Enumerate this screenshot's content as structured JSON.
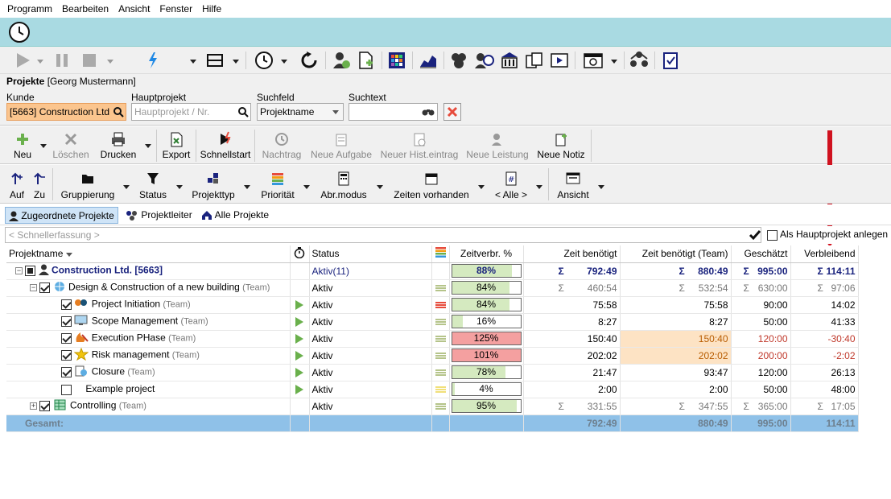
{
  "menu": [
    "Programm",
    "Bearbeiten",
    "Ansicht",
    "Fenster",
    "Hilfe"
  ],
  "header": {
    "title": "Projekte",
    "user": "[Georg Mustermann]"
  },
  "filters": {
    "kunde_label": "Kunde",
    "kunde_value": "[5663] Construction Ltd",
    "haupt_label": "Hauptprojekt",
    "haupt_placeholder": "Hauptprojekt / Nr.",
    "such_label": "Suchfeld",
    "such_value": "Projektname",
    "text_label": "Suchtext",
    "text_value": ""
  },
  "toolbar2": {
    "neu": "Neu",
    "loeschen": "Löschen",
    "drucken": "Drucken",
    "export": "Export",
    "schnellstart": "Schnellstart",
    "nachtrag": "Nachtrag",
    "neue_aufgabe": "Neue Aufgabe",
    "neuer_hist": "Neuer Hist.eintrag",
    "neue_leistung": "Neue Leistung",
    "neue_notiz": "Neue Notiz"
  },
  "toolbar3": {
    "auf": "Auf",
    "zu": "Zu",
    "gruppierung": "Gruppierung",
    "status": "Status",
    "projekttyp": "Projekttyp",
    "prioritaet": "Priorität",
    "abrmodus": "Abr.modus",
    "zeiten": "Zeiten vorhanden",
    "alle": "< Alle >",
    "ansicht": "Ansicht"
  },
  "viewtabs": [
    "Zugeordnete Projekte",
    "Projektleiter",
    "Alle Projekte"
  ],
  "quick": {
    "placeholder": "< Schnellerfassung >",
    "checkbox_label": "Als Hauptprojekt anlegen"
  },
  "columns": {
    "name": "Projektname",
    "status": "Status",
    "zeitverbr": "Zeitverbr. %",
    "zeit": "Zeit benötigt",
    "zeit_team": "Zeit benötigt (Team)",
    "geschaetzt": "Geschätzt",
    "verbleibend": "Verbleibend"
  },
  "rows": [
    {
      "name": "Construction Ltd. [5663]",
      "team": "",
      "status": "Aktiv(11)",
      "pct": "88%",
      "pctval": 0.88,
      "zeit": "792:49",
      "zeit_team": "880:49",
      "gesch": "995:00",
      "verb": "114:11",
      "sigma": true
    },
    {
      "name": "Design & Construction of a new building",
      "team": "(Team)",
      "status": "Aktiv",
      "pct": "84%",
      "pctval": 0.84,
      "zeit": "460:54",
      "zeit_team": "532:54",
      "gesch": "630:00",
      "verb": "97:06",
      "sigma": true
    },
    {
      "name": "Project Initiation",
      "team": "(Team)",
      "status": "Aktiv",
      "pct": "84%",
      "pctval": 0.84,
      "zeit": "75:58",
      "zeit_team": "75:58",
      "gesch": "90:00",
      "verb": "14:02"
    },
    {
      "name": "Scope Management",
      "team": "(Team)",
      "status": "Aktiv",
      "pct": "16%",
      "pctval": 0.16,
      "zeit": "8:27",
      "zeit_team": "8:27",
      "gesch": "50:00",
      "verb": "41:33"
    },
    {
      "name": "Execution PHase",
      "team": "(Team)",
      "status": "Aktiv",
      "pct": "125%",
      "pctval": 1.25,
      "zeit": "150:40",
      "zeit_team": "150:40",
      "gesch": "120:00",
      "verb": "-30:40"
    },
    {
      "name": "Risk management",
      "team": "(Team)",
      "status": "Aktiv",
      "pct": "101%",
      "pctval": 1.01,
      "zeit": "202:02",
      "zeit_team": "202:02",
      "gesch": "200:00",
      "verb": "-2:02"
    },
    {
      "name": "Closure",
      "team": "(Team)",
      "status": "Aktiv",
      "pct": "78%",
      "pctval": 0.78,
      "zeit": "21:47",
      "zeit_team": "93:47",
      "gesch": "120:00",
      "verb": "26:13"
    },
    {
      "name": "Example project",
      "team": "",
      "status": "Aktiv",
      "pct": "4%",
      "pctval": 0.04,
      "zeit": "2:00",
      "zeit_team": "2:00",
      "gesch": "50:00",
      "verb": "48:00"
    },
    {
      "name": "Controlling",
      "team": "(Team)",
      "status": "Aktiv",
      "pct": "95%",
      "pctval": 0.95,
      "zeit": "331:55",
      "zeit_team": "347:55",
      "gesch": "365:00",
      "verb": "17:05",
      "sigma": true
    }
  ],
  "total": {
    "label": "Gesamt:",
    "zeit": "792:49",
    "zeit_team": "880:49",
    "gesch": "995:00",
    "verb": "114:11"
  },
  "sigma": "Σ",
  "colors": {
    "banner": "#a9dae2",
    "accent_arrow": "#d0121f",
    "total_row": "#8fc1e8"
  }
}
